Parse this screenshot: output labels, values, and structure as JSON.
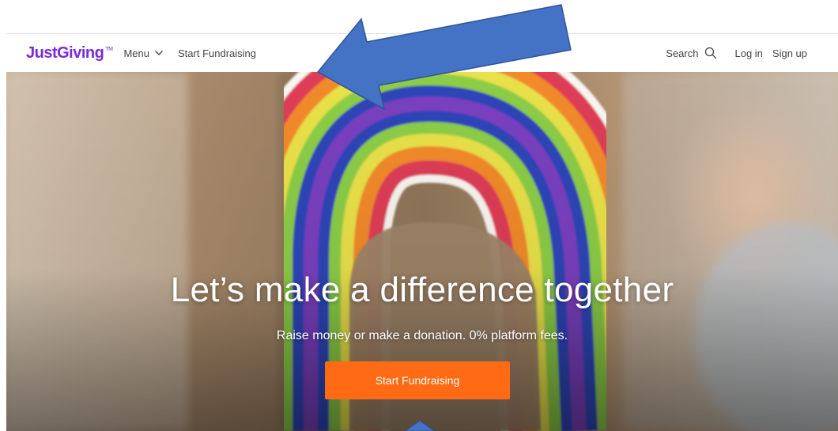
{
  "header": {
    "logo_text": "JustGiving",
    "logo_tm": "TM",
    "menu_label": "Menu",
    "start_fundraising_label": "Start Fundraising",
    "search_label": "Search",
    "login_label": "Log in",
    "signup_label": "Sign up"
  },
  "hero": {
    "title": "Let’s make a difference together",
    "subtitle": "Raise money or make a donation. 0% platform fees.",
    "cta_label": "Start Fundraising"
  },
  "colors": {
    "brand_purple": "#7a2ad6",
    "cta_orange": "#ff6a14",
    "annotation_arrow_blue": "#4472c4"
  },
  "icons": [
    "chevron-down-icon",
    "search-icon",
    "annotation-arrow-icon"
  ]
}
